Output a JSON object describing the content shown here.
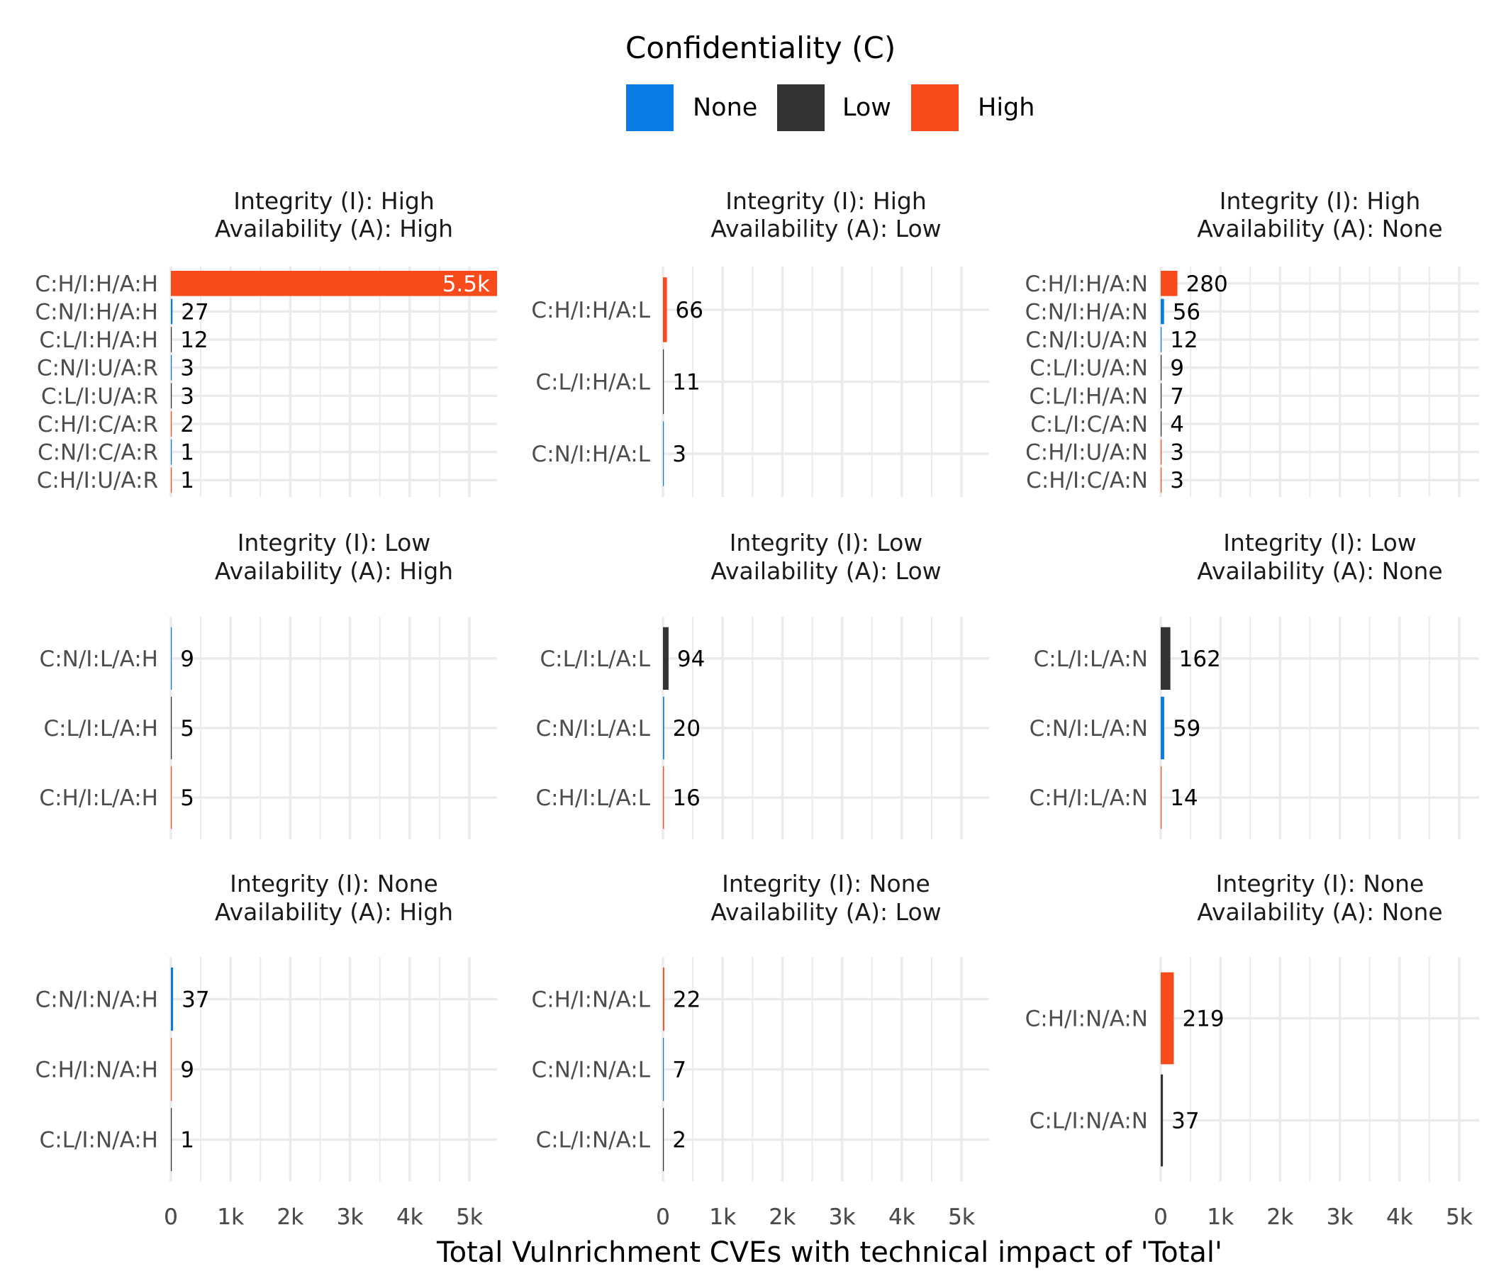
{
  "chart_data": {
    "type": "bar",
    "orientation": "horizontal",
    "facet_layout": "3x3 grid",
    "xlabel": "Total Vulnrichment CVEs with technical impact of 'Total'",
    "ylabel": "",
    "xlim": [
      0,
      5500
    ],
    "x_ticks": [
      0,
      1000,
      2000,
      3000,
      4000,
      5000
    ],
    "x_tick_labels": [
      "0",
      "1k",
      "2k",
      "3k",
      "4k",
      "5k"
    ],
    "grid": true,
    "legend": {
      "title": "Confidentiality (C)",
      "placement": "top-center",
      "entries": [
        {
          "key": "N",
          "label": "None",
          "color": "#0a7be4"
        },
        {
          "key": "L",
          "label": "Low",
          "color": "#333333"
        },
        {
          "key": "H",
          "label": "High",
          "color": "#f84b1b"
        }
      ]
    },
    "panels": [
      {
        "strip": [
          "Integrity (I): High",
          "Availability (A): High"
        ],
        "bars": [
          {
            "category": "C:H/I:H/A:H",
            "value": 5500,
            "label": "5.5k",
            "conf": "H",
            "label_inside": true
          },
          {
            "category": "C:N/I:H/A:H",
            "value": 27,
            "label": "27",
            "conf": "N"
          },
          {
            "category": "C:L/I:H/A:H",
            "value": 12,
            "label": "12",
            "conf": "L"
          },
          {
            "category": "C:N/I:U/A:R",
            "value": 3,
            "label": "3",
            "conf": "N"
          },
          {
            "category": "C:L/I:U/A:R",
            "value": 3,
            "label": "3",
            "conf": "L"
          },
          {
            "category": "C:H/I:C/A:R",
            "value": 2,
            "label": "2",
            "conf": "H"
          },
          {
            "category": "C:N/I:C/A:R",
            "value": 1,
            "label": "1",
            "conf": "N"
          },
          {
            "category": "C:H/I:U/A:R",
            "value": 1,
            "label": "1",
            "conf": "H"
          }
        ]
      },
      {
        "strip": [
          "Integrity (I): High",
          "Availability (A): Low"
        ],
        "bars": [
          {
            "category": "C:H/I:H/A:L",
            "value": 66,
            "label": "66",
            "conf": "H"
          },
          {
            "category": "C:L/I:H/A:L",
            "value": 11,
            "label": "11",
            "conf": "L"
          },
          {
            "category": "C:N/I:H/A:L",
            "value": 3,
            "label": "3",
            "conf": "N"
          }
        ]
      },
      {
        "strip": [
          "Integrity (I): High",
          "Availability (A): None"
        ],
        "bars": [
          {
            "category": "C:H/I:H/A:N",
            "value": 280,
            "label": "280",
            "conf": "H"
          },
          {
            "category": "C:N/I:H/A:N",
            "value": 56,
            "label": "56",
            "conf": "N"
          },
          {
            "category": "C:N/I:U/A:N",
            "value": 12,
            "label": "12",
            "conf": "N"
          },
          {
            "category": "C:L/I:U/A:N",
            "value": 9,
            "label": "9",
            "conf": "L"
          },
          {
            "category": "C:L/I:H/A:N",
            "value": 7,
            "label": "7",
            "conf": "L"
          },
          {
            "category": "C:L/I:C/A:N",
            "value": 4,
            "label": "4",
            "conf": "L"
          },
          {
            "category": "C:H/I:U/A:N",
            "value": 3,
            "label": "3",
            "conf": "H"
          },
          {
            "category": "C:H/I:C/A:N",
            "value": 3,
            "label": "3",
            "conf": "H"
          }
        ]
      },
      {
        "strip": [
          "Integrity (I): Low",
          "Availability (A): High"
        ],
        "bars": [
          {
            "category": "C:N/I:L/A:H",
            "value": 9,
            "label": "9",
            "conf": "N"
          },
          {
            "category": "C:L/I:L/A:H",
            "value": 5,
            "label": "5",
            "conf": "L"
          },
          {
            "category": "C:H/I:L/A:H",
            "value": 5,
            "label": "5",
            "conf": "H"
          }
        ]
      },
      {
        "strip": [
          "Integrity (I): Low",
          "Availability (A): Low"
        ],
        "bars": [
          {
            "category": "C:L/I:L/A:L",
            "value": 94,
            "label": "94",
            "conf": "L"
          },
          {
            "category": "C:N/I:L/A:L",
            "value": 20,
            "label": "20",
            "conf": "N"
          },
          {
            "category": "C:H/I:L/A:L",
            "value": 16,
            "label": "16",
            "conf": "H"
          }
        ]
      },
      {
        "strip": [
          "Integrity (I): Low",
          "Availability (A): None"
        ],
        "bars": [
          {
            "category": "C:L/I:L/A:N",
            "value": 162,
            "label": "162",
            "conf": "L"
          },
          {
            "category": "C:N/I:L/A:N",
            "value": 59,
            "label": "59",
            "conf": "N"
          },
          {
            "category": "C:H/I:L/A:N",
            "value": 14,
            "label": "14",
            "conf": "H"
          }
        ]
      },
      {
        "strip": [
          "Integrity (I): None",
          "Availability (A): High"
        ],
        "bars": [
          {
            "category": "C:N/I:N/A:H",
            "value": 37,
            "label": "37",
            "conf": "N"
          },
          {
            "category": "C:H/I:N/A:H",
            "value": 9,
            "label": "9",
            "conf": "H"
          },
          {
            "category": "C:L/I:N/A:H",
            "value": 1,
            "label": "1",
            "conf": "L"
          }
        ]
      },
      {
        "strip": [
          "Integrity (I): None",
          "Availability (A): Low"
        ],
        "bars": [
          {
            "category": "C:H/I:N/A:L",
            "value": 22,
            "label": "22",
            "conf": "H"
          },
          {
            "category": "C:N/I:N/A:L",
            "value": 7,
            "label": "7",
            "conf": "N"
          },
          {
            "category": "C:L/I:N/A:L",
            "value": 2,
            "label": "2",
            "conf": "L"
          }
        ]
      },
      {
        "strip": [
          "Integrity (I): None",
          "Availability (A): None"
        ],
        "bars": [
          {
            "category": "C:H/I:N/A:N",
            "value": 219,
            "label": "219",
            "conf": "H"
          },
          {
            "category": "C:L/I:N/A:N",
            "value": 37,
            "label": "37",
            "conf": "L"
          }
        ]
      }
    ]
  }
}
